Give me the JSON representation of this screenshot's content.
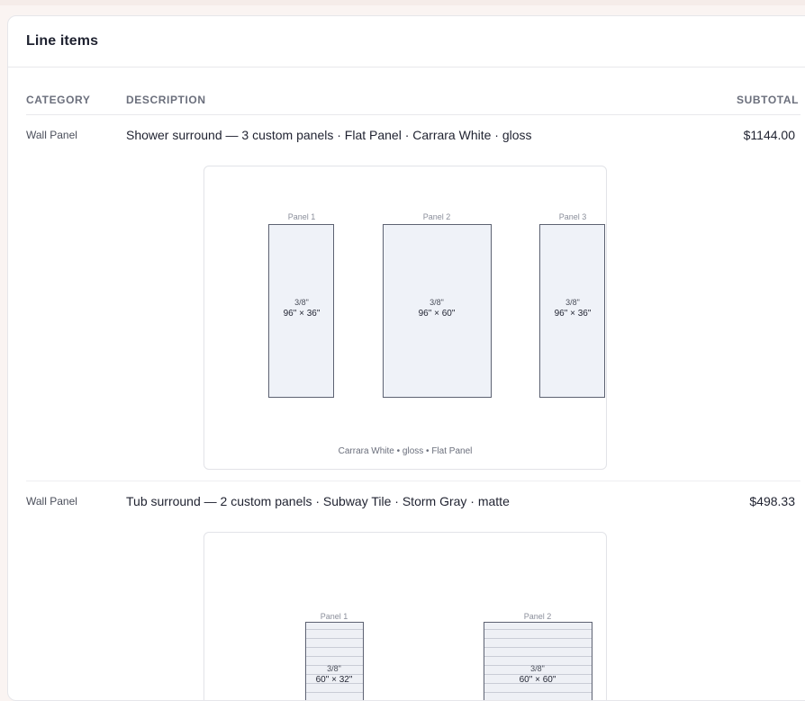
{
  "section": {
    "title": "Line items"
  },
  "columns": {
    "category": "CATEGORY",
    "description": "DESCRIPTION",
    "subtotal": "SUBTOTAL"
  },
  "rows": [
    {
      "category": "Wall Panel",
      "description": "Shower surround — 3 custom panels · Flat Panel · Carrara White · gloss",
      "subtotal": "$1144.00",
      "panels": [
        {
          "label": "Panel 1",
          "thickness": "3/8\"",
          "size": "96\" × 36\""
        },
        {
          "label": "Panel 2",
          "thickness": "3/8\"",
          "size": "96\" × 60\""
        },
        {
          "label": "Panel 3",
          "thickness": "3/8\"",
          "size": "96\" × 36\""
        }
      ],
      "caption": "Carrara White • gloss • Flat Panel"
    },
    {
      "category": "Wall Panel",
      "description": "Tub surround — 2 custom panels · Subway Tile · Storm Gray · matte",
      "subtotal": "$498.33",
      "panels": [
        {
          "label": "Panel 1",
          "thickness": "3/8\"",
          "size": "60\" × 32\""
        },
        {
          "label": "Panel 2",
          "thickness": "3/8\"",
          "size": "60\" × 60\""
        }
      ]
    }
  ]
}
